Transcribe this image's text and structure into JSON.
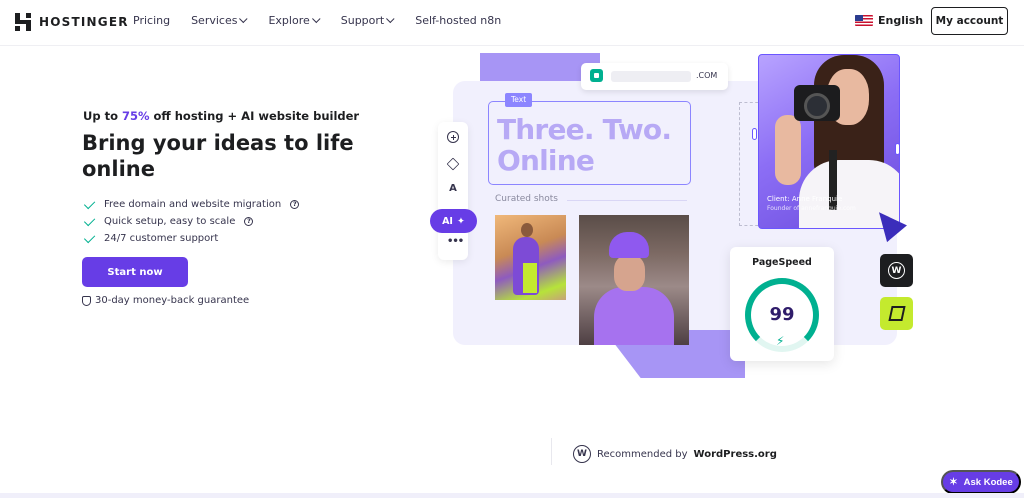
{
  "header": {
    "brand": "HOSTINGER",
    "nav": [
      {
        "label": "Pricing",
        "has_dropdown": false
      },
      {
        "label": "Services",
        "has_dropdown": true
      },
      {
        "label": "Explore",
        "has_dropdown": true
      },
      {
        "label": "Support",
        "has_dropdown": true
      },
      {
        "label": "Self-hosted n8n",
        "has_dropdown": false
      }
    ],
    "language": "English",
    "account_label": "My account"
  },
  "hero": {
    "promo_prefix": "Up to ",
    "promo_percent": "75%",
    "promo_suffix": " off hosting + AI website builder",
    "headline": "Bring your ideas to life online",
    "features": [
      {
        "text": "Free domain and website migration",
        "help": true
      },
      {
        "text": "Quick setup, easy to scale",
        "help": true
      },
      {
        "text": "24/7 customer support",
        "help": false
      }
    ],
    "cta_label": "Start now",
    "guarantee": "30-day money-back guarantee"
  },
  "builder": {
    "url_tld": ".COM",
    "text_tag": "Text",
    "big_text_line1": "Three. Two.",
    "big_text_line2": "Online",
    "curated_label": "Curated shots",
    "ai_label": "AI",
    "client_name": "Client: Anne Franquie",
    "client_sub": "Founder of annefranquie.com",
    "pagespeed_title": "PageSpeed",
    "pagespeed_score": "99"
  },
  "footer": {
    "recommended_prefix": "Recommended by",
    "recommended_brand": "WordPress.org",
    "kodee_label": "Ask Kodee"
  },
  "colors": {
    "accent": "#673de6",
    "success": "#00b090",
    "lime": "#c4ea2e"
  }
}
